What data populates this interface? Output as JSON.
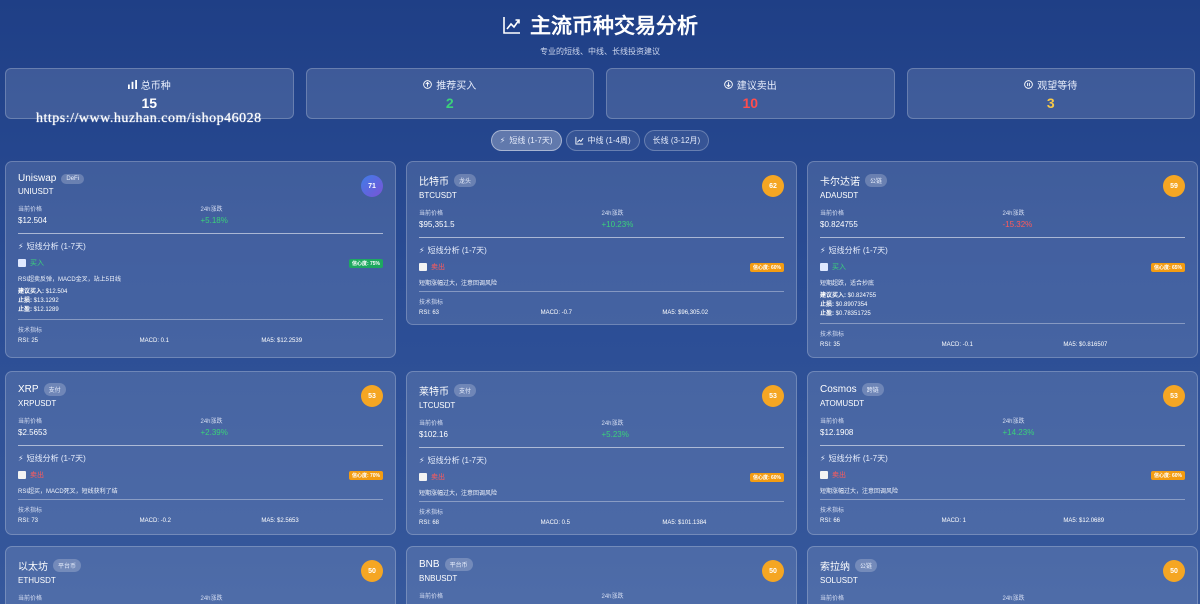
{
  "header": {
    "title": "主流币种交易分析",
    "subtitle": "专业的短线、中线、长线投资建议"
  },
  "stats": [
    {
      "label": "总币种",
      "value": "15",
      "color": "#ffffff",
      "icon": "bar-chart-icon"
    },
    {
      "label": "推荐买入",
      "value": "2",
      "color": "#3bd27a",
      "icon": "arrow-up-circle-icon"
    },
    {
      "label": "建议卖出",
      "value": "10",
      "color": "#ff4d4d",
      "icon": "arrow-down-circle-icon"
    },
    {
      "label": "观望等待",
      "value": "3",
      "color": "#f7c948",
      "icon": "pause-circle-icon"
    }
  ],
  "watermark": "https://www.huzhan.com/ishop46028",
  "tabs": [
    {
      "label": "短线 (1-7天)",
      "icon": "lightning-icon",
      "active": true
    },
    {
      "label": "中线 (1-4周)",
      "icon": "trend-icon",
      "active": false
    },
    {
      "label": "长线 (3-12月)",
      "icon": "",
      "active": false
    }
  ],
  "labels": {
    "price": "当前价格",
    "change": "24h涨跌",
    "analysis": "短线分析 (1-7天)",
    "tech": "技术指标",
    "entry": "建议买入:",
    "stop": "止损:",
    "target": "止盈:"
  },
  "cards": [
    {
      "name": "Uniswap",
      "tag": "DeFi",
      "symbol": "UNIUSDT",
      "score": "71",
      "price": "$12.504",
      "change": "+5.18%",
      "dir": "up",
      "signal": "买入",
      "signal_type": "buy",
      "confidence": "信心度: 75%",
      "reason": "RSI超卖反弹，MACD金叉，站上5日线",
      "entry": "$12.504",
      "stop": "$13.1292",
      "target": "$12.1289",
      "rsi": "RSI: 25",
      "macd": "MACD: 0.1",
      "ma5": "MA5: $12.2539"
    },
    {
      "name": "比特币",
      "tag": "龙头",
      "symbol": "BTCUSDT",
      "score": "62",
      "price": "$95,351.5",
      "change": "+10.23%",
      "dir": "up",
      "signal": "卖出",
      "signal_type": "sell",
      "confidence": "信心度: 60%",
      "reason": "短期涨幅过大，注意回调风险",
      "rsi": "RSI: 63",
      "macd": "MACD: -0.7",
      "ma5": "MA5: $96,305.02"
    },
    {
      "name": "卡尔达诺",
      "tag": "公链",
      "symbol": "ADAUSDT",
      "score": "59",
      "price": "$0.824755",
      "change": "-15.32%",
      "dir": "down",
      "signal": "买入",
      "signal_type": "buy",
      "confidence": "信心度: 65%",
      "reason": "短期超跌，适合抄底",
      "entry": "$0.824755",
      "stop": "$0.8907354",
      "target": "$0.78351725",
      "rsi": "RSI: 35",
      "macd": "MACD: -0.1",
      "ma5": "MA5: $0.816507"
    },
    {
      "name": "XRP",
      "tag": "支付",
      "symbol": "XRPUSDT",
      "score": "53",
      "price": "$2.5653",
      "change": "+2.39%",
      "dir": "up",
      "signal": "卖出",
      "signal_type": "sell",
      "confidence": "信心度: 70%",
      "reason": "RSI超买，MACD死叉，短线获利了结",
      "rsi": "RSI: 73",
      "macd": "MACD: -0.2",
      "ma5": "MA5: $2.5653"
    },
    {
      "name": "莱特币",
      "tag": "支付",
      "symbol": "LTCUSDT",
      "score": "53",
      "price": "$102.16",
      "change": "+5.23%",
      "dir": "up",
      "signal": "卖出",
      "signal_type": "sell",
      "confidence": "信心度: 60%",
      "reason": "短期涨幅过大，注意回调风险",
      "rsi": "RSI: 68",
      "macd": "MACD: 0.5",
      "ma5": "MA5: $101.1384"
    },
    {
      "name": "Cosmos",
      "tag": "跨链",
      "symbol": "ATOMUSDT",
      "score": "53",
      "price": "$12.1908",
      "change": "+14.23%",
      "dir": "up",
      "signal": "卖出",
      "signal_type": "sell",
      "confidence": "信心度: 60%",
      "reason": "短期涨幅过大，注意回调风险",
      "rsi": "RSI: 66",
      "macd": "MACD: 1",
      "ma5": "MA5: $12.0689"
    },
    {
      "name": "以太坊",
      "tag": "平台币",
      "symbol": "ETHUSDT",
      "score": "50"
    },
    {
      "name": "BNB",
      "tag": "平台币",
      "symbol": "BNBUSDT",
      "score": "50"
    },
    {
      "name": "索拉纳",
      "tag": "公链",
      "symbol": "SOLUSDT",
      "score": "50"
    }
  ]
}
